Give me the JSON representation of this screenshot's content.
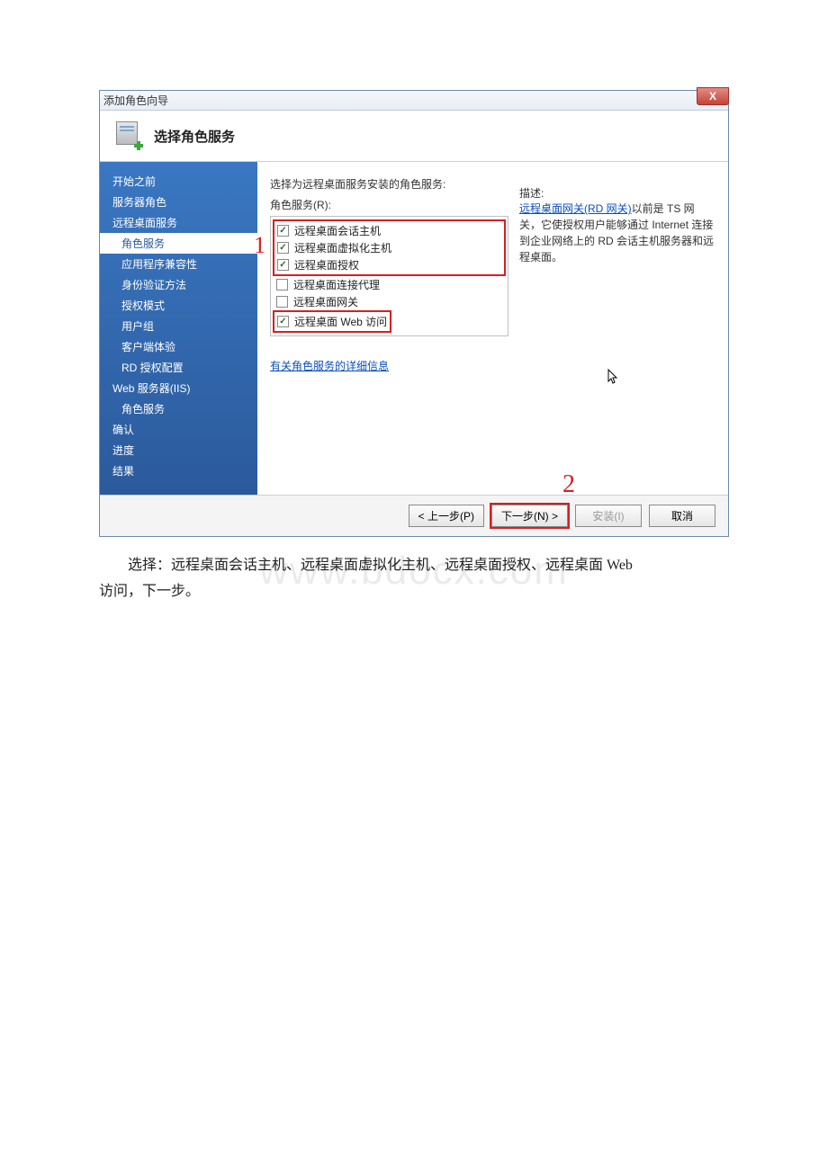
{
  "window": {
    "title": "添加角色向导",
    "close": "X"
  },
  "header": {
    "title": "选择角色服务"
  },
  "sidebar": {
    "items": [
      {
        "label": "开始之前",
        "indent": 0
      },
      {
        "label": "服务器角色",
        "indent": 0
      },
      {
        "label": "远程桌面服务",
        "indent": 0
      },
      {
        "label": "角色服务",
        "indent": 1,
        "selected": true
      },
      {
        "label": "应用程序兼容性",
        "indent": 1
      },
      {
        "label": "身份验证方法",
        "indent": 1
      },
      {
        "label": "授权模式",
        "indent": 1
      },
      {
        "label": "用户组",
        "indent": 1
      },
      {
        "label": "客户端体验",
        "indent": 1
      },
      {
        "label": "RD 授权配置",
        "indent": 1
      },
      {
        "label": "Web 服务器(IIS)",
        "indent": 0
      },
      {
        "label": "角色服务",
        "indent": 1
      },
      {
        "label": "确认",
        "indent": 0
      },
      {
        "label": "进度",
        "indent": 0
      },
      {
        "label": "结果",
        "indent": 0
      }
    ]
  },
  "content": {
    "instruction": "选择为远程桌面服务安装的角色服务:",
    "sub_label": "角色服务(R):",
    "roles": [
      {
        "label": "远程桌面会话主机",
        "checked": true,
        "group": 1
      },
      {
        "label": "远程桌面虚拟化主机",
        "checked": true,
        "group": 1
      },
      {
        "label": "远程桌面授权",
        "checked": true,
        "group": 1
      },
      {
        "label": "远程桌面连接代理",
        "checked": false,
        "group": 0
      },
      {
        "label": "远程桌面网关",
        "checked": false,
        "group": 0
      },
      {
        "label": "远程桌面 Web 访问",
        "checked": true,
        "group": 2
      }
    ],
    "desc_label": "描述:",
    "desc_link": "远程桌面网关(RD 网关)",
    "desc_text": "以前是 TS 网关，它使授权用户能够通过 Internet 连接到企业网络上的 RD 会话主机服务器和远程桌面。",
    "more_link": "有关角色服务的详细信息",
    "annotation1": "1",
    "annotation2": "2"
  },
  "footer": {
    "prev": "< 上一步(P)",
    "next": "下一步(N) >",
    "install": "安装(I)",
    "cancel": "取消"
  },
  "caption": {
    "line1": "选择：远程桌面会话主机、远程桌面虚拟化主机、远程桌面授权、远程桌面 Web",
    "line2": "访问，下一步。"
  },
  "watermark": "www.bdocx.com"
}
